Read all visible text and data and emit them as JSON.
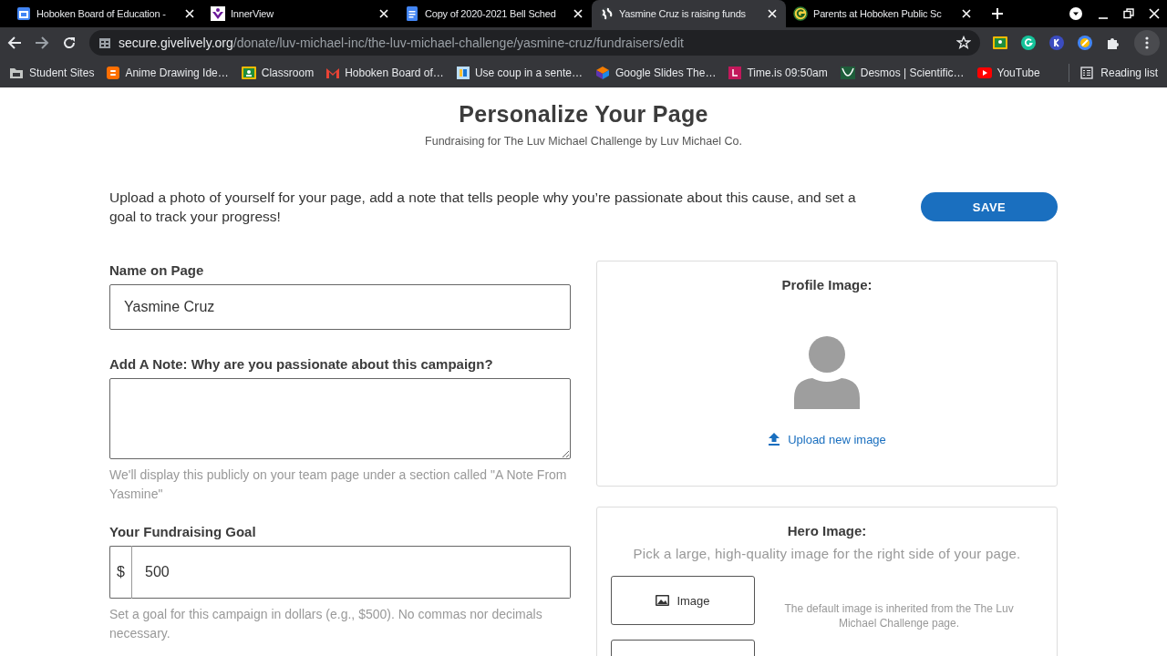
{
  "browser": {
    "tabs": [
      {
        "label": "Hoboken Board of Education -",
        "selected": false
      },
      {
        "label": "InnerView",
        "selected": false
      },
      {
        "label": "Copy of 2020-2021 Bell Sched",
        "selected": false
      },
      {
        "label": "Yasmine Cruz is raising funds",
        "selected": true
      },
      {
        "label": "Parents at Hoboken Public Sc",
        "selected": false
      }
    ],
    "address": {
      "host": "secure.givelively.org",
      "path": "/donate/luv-michael-inc/the-luv-michael-challenge/yasmine-cruz/fundraisers/edit"
    },
    "bookmarks": [
      "Student Sites",
      "Anime Drawing Ide…",
      "Classroom",
      "Hoboken Board of…",
      "Use coup in a sente…",
      "Google Slides The…",
      "Time.is 09:50am",
      "Desmos | Scientific…",
      "YouTube"
    ],
    "reading_list": "Reading list"
  },
  "page": {
    "title": "Personalize Your Page",
    "subtitle": "Fundraising for The Luv Michael Challenge by Luv Michael Co.",
    "intro": "Upload a photo of yourself for your page, add a note that tells people why you’re passionate about this cause, and set a goal to track your progress!",
    "save_button": "SAVE",
    "name_field": {
      "label": "Name on Page",
      "value": "Yasmine Cruz"
    },
    "note_field": {
      "label": "Add A Note: Why are you passionate about this campaign?",
      "help": "We'll display this publicly on your team page under a section called \"A Note From Yasmine\""
    },
    "goal_field": {
      "label": "Your Fundraising Goal",
      "prefix": "$",
      "value": "500",
      "help": "Set a goal for this campaign in dollars (e.g., $500). No commas nor decimals necessary."
    },
    "profile_card": {
      "title": "Profile Image:",
      "upload_link": "Upload new image"
    },
    "hero_card": {
      "title": "Hero Image:",
      "hint": "Pick a large, high-quality image for the right side of your page.",
      "image_button": "Image",
      "note": "The default image is inherited from the The Luv Michael Challenge page."
    }
  }
}
